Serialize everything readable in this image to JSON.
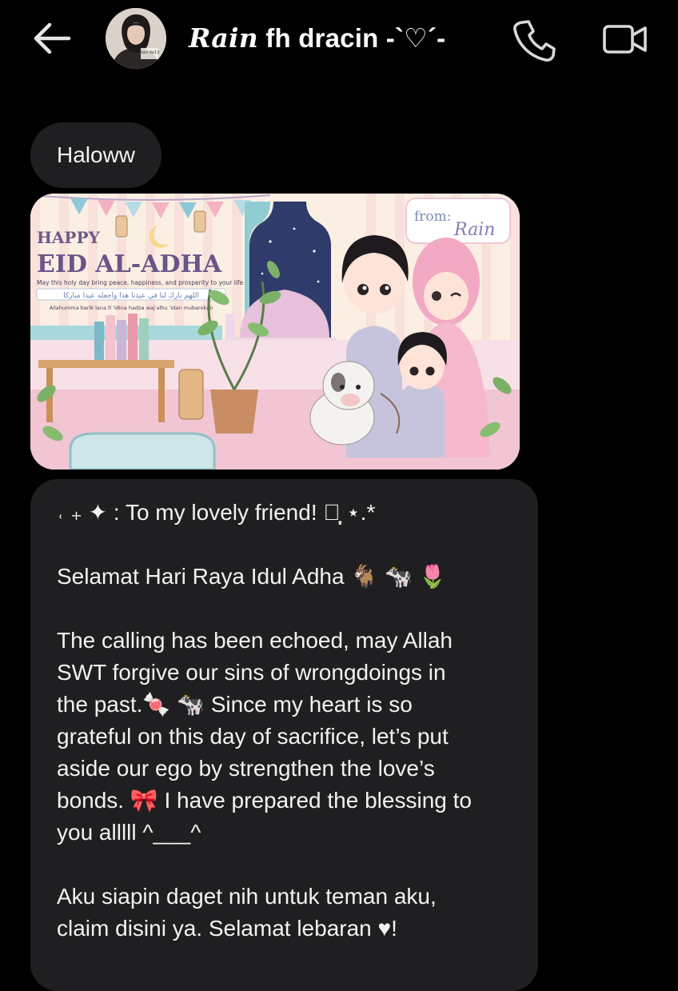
{
  "header": {
    "contact_name_italic": "Rain",
    "contact_name_rest": " fh dracin -`♡´-",
    "avatar_caption": "Rain fw13"
  },
  "messages": {
    "greeting": "Haloww",
    "card": {
      "happy": "HAPPY",
      "eid": "EID AL-ADHA",
      "wish": "May this holy day bring peace, happiness, and prosperity to your life",
      "arabic": "اللهم بارك لنا في عيدنا هذا واجعله عيدا مباركا",
      "transliteration": "Allahumma barik lana fi 'idina hadza waj'alhu 'idan mubarokan",
      "from": "from:",
      "from_name": "Rain"
    },
    "body": {
      "l1": "˓ ₊ ✦ : To my lovely friend! ✿̩͙ ⋆.*",
      "l2": "Selamat Hari Raya Idul Adha 🐐 🐄 🌷",
      "l3": "The calling has been echoed, may Allah",
      "l4": "SWT forgive our sins of wrongdoings in",
      "l5": "the past.🍬 🐄 Since my heart is so",
      "l6": "grateful on this day of sacrifice, let’s put",
      "l7": "aside our ego by strengthen the love’s",
      "l8": "bonds. 🎀 I have prepared the blessing to",
      "l9": "you alllll ^___^",
      "l10": "Aku siapin daget nih untuk teman aku,",
      "l11": "claim disini ya. Selamat lebaran ♥!"
    }
  },
  "icons": {
    "back": "back-arrow-icon",
    "call": "phone-icon",
    "video": "video-camera-icon"
  },
  "colors": {
    "background": "#000000",
    "bubble": "#1f1f21",
    "text": "#f2f2f2",
    "icon": "#d9d9d9"
  }
}
